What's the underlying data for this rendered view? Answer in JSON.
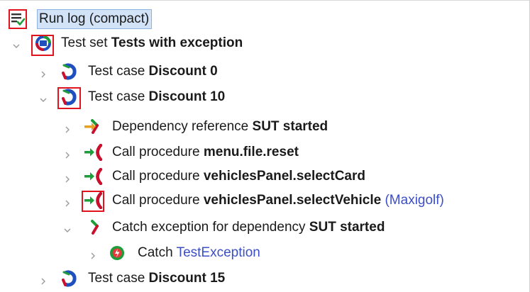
{
  "root": {
    "label": "Run log (compact)",
    "icon": "run-log-icon"
  },
  "rows": [
    {
      "kind": "Test set",
      "name": "Tests with exception",
      "expanded": true,
      "icon": "test-set-icon"
    },
    {
      "kind": "Test case",
      "name": "Discount 0",
      "expanded": false,
      "icon": "test-case-icon"
    },
    {
      "kind": "Test case",
      "name": "Discount 10",
      "expanded": true,
      "icon": "test-case-icon"
    },
    {
      "kind": "Dependency reference",
      "name": "SUT started",
      "expanded": false,
      "icon": "dependency-reference-icon"
    },
    {
      "kind": "Call procedure",
      "name": "menu.file.reset",
      "expanded": false,
      "icon": "call-procedure-icon"
    },
    {
      "kind": "Call procedure",
      "name": "vehiclesPanel.selectCard",
      "expanded": false,
      "icon": "call-procedure-icon"
    },
    {
      "kind": "Call procedure",
      "name": "vehiclesPanel.selectVehicle",
      "param": "(Maxigolf)",
      "expanded": false,
      "icon": "call-procedure-icon"
    },
    {
      "kind": "Catch exception for dependency",
      "name": "SUT started",
      "expanded": true,
      "icon": "catch-exception-icon"
    },
    {
      "kind": "Catch",
      "name": "TestException",
      "expanded": false,
      "icon": "catch-icon"
    },
    {
      "kind": "Test case",
      "name": "Discount 15",
      "expanded": false,
      "icon": "test-case-icon"
    }
  ],
  "colors": {
    "highlight": "#e0141e",
    "selection": "#d2e3f8",
    "link": "#3c4fc4",
    "arrow_green": "#1e9e3a",
    "procedure_red": "#c8102e",
    "dependency_orange": "#e8a020",
    "test_blue": "#1f4fbf"
  }
}
